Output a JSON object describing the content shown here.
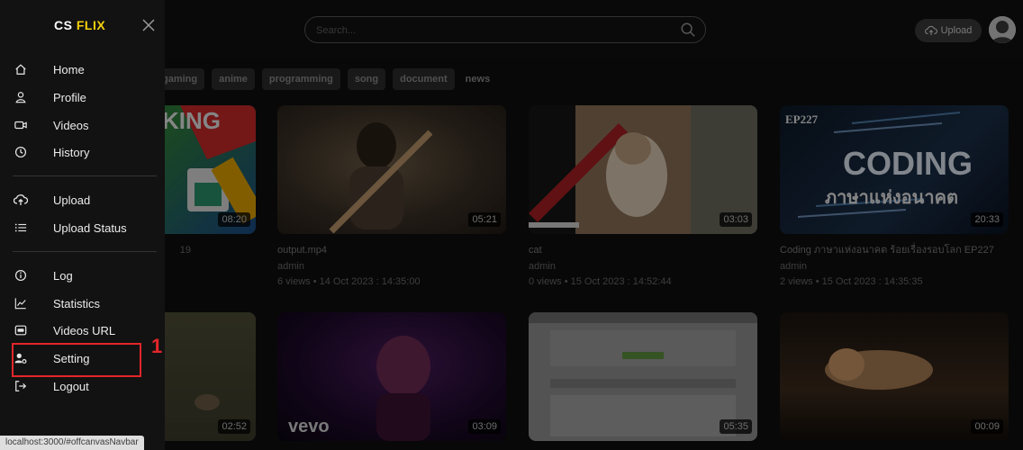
{
  "header": {
    "search_placeholder": "Search...",
    "upload_label": "Upload"
  },
  "brand": {
    "cs": "CS",
    "flix": "FLIX"
  },
  "sidebar": {
    "groups": [
      [
        {
          "label": "Home",
          "icon": "home-icon"
        },
        {
          "label": "Profile",
          "icon": "person-icon"
        },
        {
          "label": "Videos",
          "icon": "video-camera-icon"
        },
        {
          "label": "History",
          "icon": "clock-icon"
        }
      ],
      [
        {
          "label": "Upload",
          "icon": "cloud-upload-icon"
        },
        {
          "label": "Upload Status",
          "icon": "list-icon"
        }
      ],
      [
        {
          "label": "Log",
          "icon": "info-icon"
        },
        {
          "label": "Statistics",
          "icon": "line-chart-icon"
        },
        {
          "label": "Videos URL",
          "icon": "link-box-icon"
        },
        {
          "label": "Setting",
          "icon": "user-gear-icon"
        },
        {
          "label": "Logout",
          "icon": "logout-icon"
        }
      ]
    ]
  },
  "callout_number": "1",
  "chips": [
    "gaming",
    "anime",
    "programming",
    "song",
    "document",
    "news"
  ],
  "videos": [
    {
      "title": "",
      "channel": "",
      "stats": "19",
      "duration": "08:20",
      "thumb_text": "KING"
    },
    {
      "title": "output.mp4",
      "channel": "admin",
      "stats": "6 views • 14 Oct 2023 : 14:35:00",
      "duration": "05:21"
    },
    {
      "title": "cat",
      "channel": "admin",
      "stats": "0 views • 15 Oct 2023 : 14:52:44",
      "duration": "03:03"
    },
    {
      "title": "Coding ภาษาแห่งอนาคต ร้อยเรื่องรอบโลก EP227",
      "channel": "admin",
      "stats": "2 views • 15 Oct 2023 : 14:35:35",
      "duration": "20:33",
      "thumb_text": [
        "EP227",
        "CODING",
        "ภาษาแห่งอนาคต"
      ]
    },
    {
      "title": "",
      "channel": "",
      "stats": "",
      "duration": "02:52"
    },
    {
      "title": "",
      "channel": "",
      "stats": "",
      "duration": "03:09",
      "thumb_text": "vevo"
    },
    {
      "title": "",
      "channel": "",
      "stats": "",
      "duration": "05:35"
    },
    {
      "title": "",
      "channel": "",
      "stats": "",
      "duration": "00:09"
    }
  ],
  "status_url": "localhost:3000/#offcanvasNavbar",
  "colors": {
    "brand_accent": "#f5d10c",
    "highlight": "#e3262a"
  }
}
